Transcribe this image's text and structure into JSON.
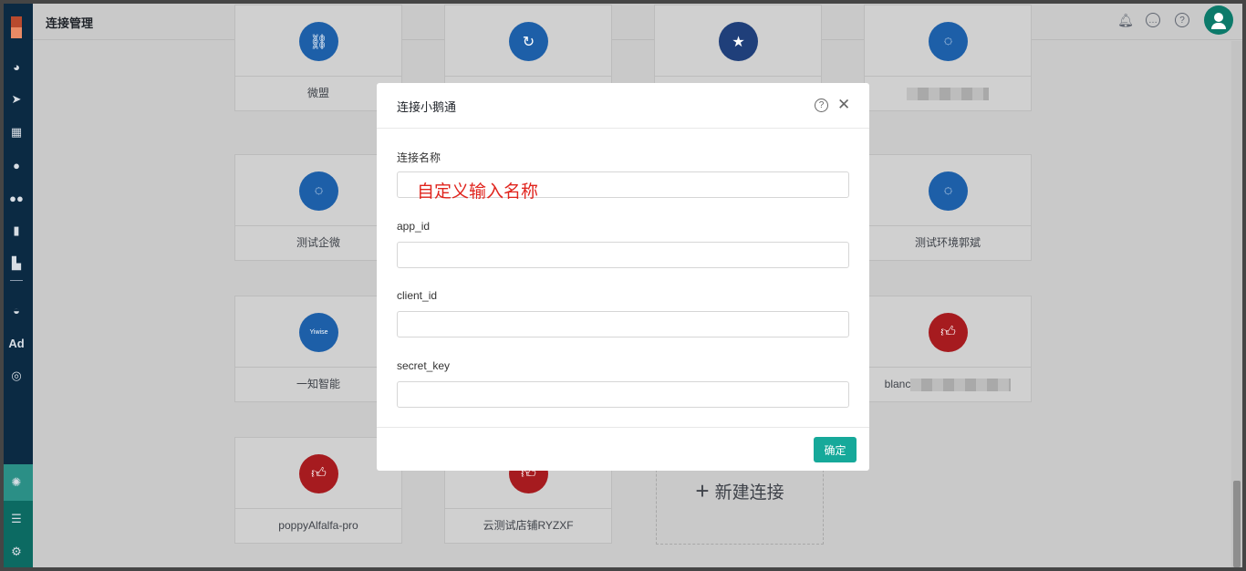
{
  "header": {
    "title": "连接管理"
  },
  "sidebar": {
    "icons": [
      "dashboard-icon",
      "send-icon",
      "layout-icon",
      "user-icon",
      "users-icon",
      "bookmark-icon",
      "bar-chart-icon",
      "wechat-icon",
      "ad-icon",
      "target-icon"
    ],
    "ad_label": "Ad",
    "bottom_icons": [
      "hub-icon",
      "server-icon",
      "gear-icon"
    ]
  },
  "cards": [
    {
      "label": "微盟",
      "icon": "link-icon",
      "color": "#1d5fa8"
    },
    {
      "label": "",
      "icon": "refresh-icon",
      "color": "#1d5fa8"
    },
    {
      "label": "",
      "icon": "star-icon",
      "color": "#1f3f7a"
    },
    {
      "label": "",
      "icon": "chat-icon",
      "color": "#1d5fa8"
    },
    {
      "label": "测试企微",
      "icon": "chat-icon",
      "color": "#1d5fa8"
    },
    {
      "label": "测试环境郭斌",
      "icon": "chat-icon",
      "color": "#1d5fa8"
    },
    {
      "label": "一知智能",
      "icon": "yiwise-icon",
      "color": "#1d5fa8"
    },
    {
      "label": "blanc",
      "icon": "thumbs-up-icon",
      "color": "#a61b1f"
    },
    {
      "label": "poppyAlfalfa-pro",
      "icon": "thumbs-up-icon",
      "color": "#a61b1f"
    },
    {
      "label": "云测试店铺RYZXF",
      "icon": "thumbs-up-icon",
      "color": "#a61b1f"
    }
  ],
  "new_connection": {
    "label": "新建连接"
  },
  "modal": {
    "title": "连接小鹅通",
    "fields": [
      {
        "label": "连接名称",
        "value": ""
      },
      {
        "label": "app_id",
        "value": ""
      },
      {
        "label": "client_id",
        "value": ""
      },
      {
        "label": "secret_key",
        "value": ""
      }
    ],
    "annotation": "自定义输入名称",
    "confirm_label": "确定"
  },
  "colors": {
    "accent": "#16a99a",
    "sidebar": "#0b2a43",
    "annotation": "#e0241d"
  }
}
